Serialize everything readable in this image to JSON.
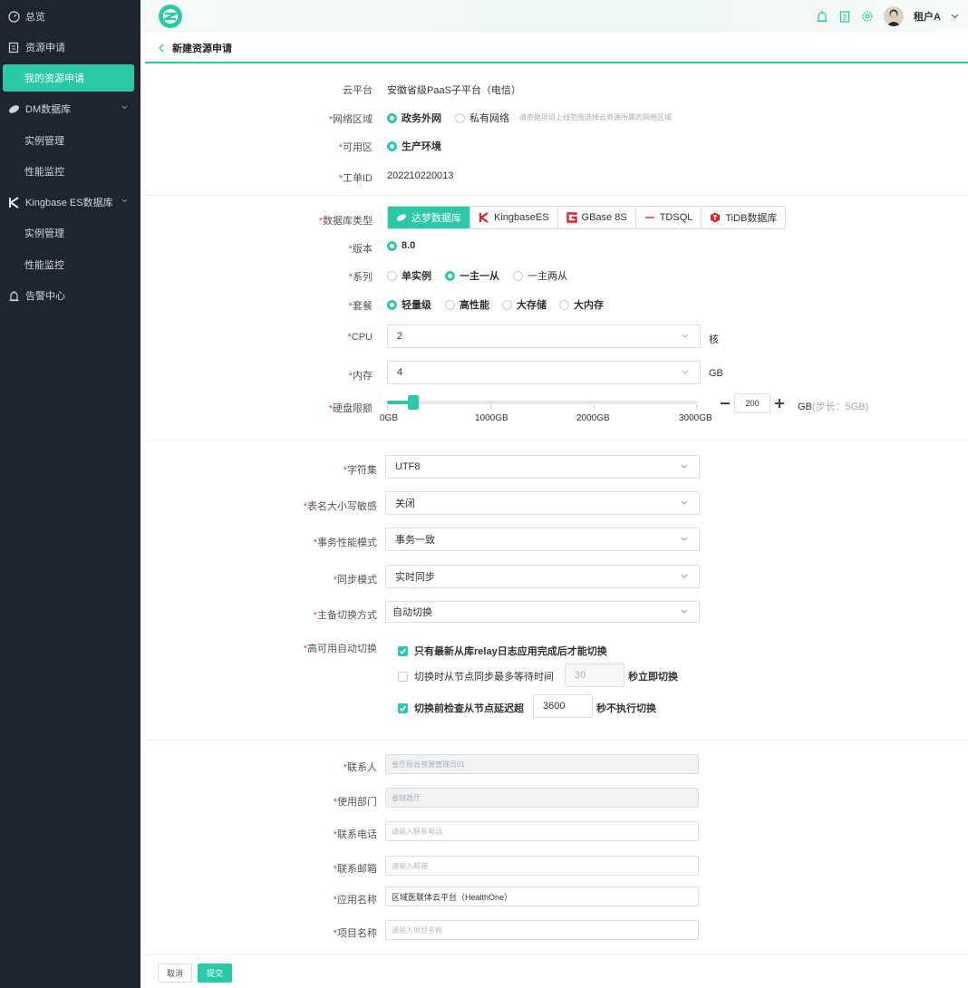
{
  "sidebar": {
    "items": [
      {
        "label": "总览"
      },
      {
        "label": "资源申请"
      },
      {
        "label": "我的资源申请"
      },
      {
        "label": "DM数据库"
      },
      {
        "label": "实例管理"
      },
      {
        "label": "性能监控"
      },
      {
        "label": "Kingbase ES数据库"
      },
      {
        "label": "实例管理"
      },
      {
        "label": "性能监控"
      },
      {
        "label": "告警中心"
      }
    ]
  },
  "header": {
    "user": "租户A"
  },
  "page": {
    "title": "新建资源申请"
  },
  "form": {
    "platform": {
      "label": "云平台",
      "value": "安徽省级PaaS子平台（电信）"
    },
    "network": {
      "label": "网络区域",
      "options": [
        "政务外网",
        "私有网络"
      ],
      "selected": "政务外网",
      "hint": "请依据项目上线范围选择云资源所属的网络区域"
    },
    "zone": {
      "label": "可用区",
      "options": [
        "生产环境"
      ],
      "selected": "生产环境"
    },
    "ticket": {
      "label": "工单ID",
      "value": "202210220013"
    },
    "db_type": {
      "label": "数据库类型",
      "options": [
        "达梦数据库",
        "KingbaseES",
        "GBase 8S",
        "TDSQL",
        "TiDB数据库"
      ],
      "selected": "达梦数据库"
    },
    "version": {
      "label": "版本",
      "options": [
        "8.0"
      ],
      "selected": "8.0"
    },
    "series": {
      "label": "系列",
      "options": [
        "单实例",
        "一主一从",
        "一主两从"
      ],
      "selected": "一主一从"
    },
    "plan": {
      "label": "套餐",
      "options": [
        "轻量级",
        "高性能",
        "大存储",
        "大内存"
      ],
      "selected": "轻量级"
    },
    "cpu": {
      "label": "CPU",
      "value": "2",
      "unit": "核"
    },
    "memory": {
      "label": "内存",
      "value": "4",
      "unit": "GB"
    },
    "disk": {
      "label": "硬盘限额",
      "value": "200",
      "fraction": 0.067,
      "ticks": [
        "0GB",
        "1000GB",
        "2000GB",
        "3000GB"
      ],
      "unit": "GB",
      "step_hint": "(步长：5GB)"
    },
    "charset": {
      "label": "字符集",
      "value": "UTF8"
    },
    "case_sensitive": {
      "label": "表名大小写敏感",
      "value": "关闭"
    },
    "tx_mode": {
      "label": "事务性能模式",
      "value": "事务一致"
    },
    "sync_mode": {
      "label": "同步模式",
      "value": "实时同步"
    },
    "failover": {
      "label": "主备切换方式",
      "value": "自动切换"
    },
    "ha": {
      "label": "高可用自动切换",
      "opt1": {
        "text": "只有最新从库relay日志应用完成后才能切换",
        "checked": true
      },
      "opt2": {
        "text_before": "切换时从节点同步最多等待时间",
        "value": "30",
        "text_after": "秒立即切换",
        "checked": false
      },
      "opt3": {
        "text_before": "切换前检查从节点延迟超",
        "value": "3600",
        "text_after": "秒不执行切换",
        "checked": true
      }
    },
    "contact": {
      "label": "联系人",
      "value": "省厅局云资源管理员01"
    },
    "department": {
      "label": "使用部门",
      "value": "省财政厅"
    },
    "phone": {
      "label": "联系电话",
      "placeholder": "请输入联系电话"
    },
    "email": {
      "label": "联系邮箱",
      "placeholder": "请输入邮箱"
    },
    "app_name": {
      "label": "应用名称",
      "value": "区域医联体云平台（HealthOne）"
    },
    "project_name": {
      "label": "项目名称",
      "placeholder": "请输入项目名称"
    }
  },
  "footer": {
    "cancel": "取消",
    "submit": "提交"
  },
  "colors": {
    "accent": "#2cc9a8",
    "sidebar": "#1e2530",
    "required": "#f0413b"
  }
}
